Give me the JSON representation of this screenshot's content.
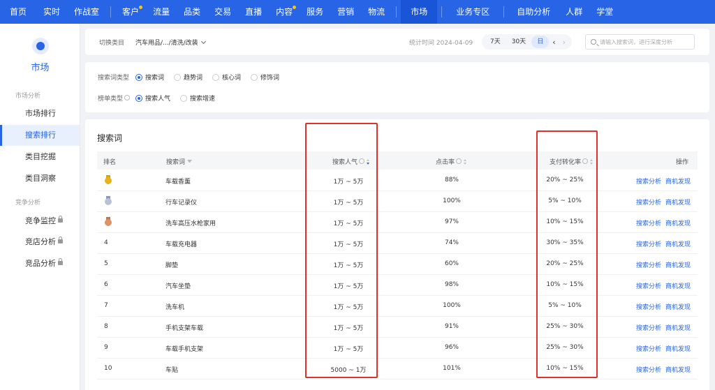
{
  "nav": {
    "items": [
      {
        "label": "首页",
        "dot": false
      },
      {
        "label": "实时",
        "dot": false
      },
      {
        "label": "作战室",
        "dot": false
      },
      {
        "label": "客户",
        "dot": true
      },
      {
        "label": "流量",
        "dot": false
      },
      {
        "label": "品类",
        "dot": false
      },
      {
        "label": "交易",
        "dot": false
      },
      {
        "label": "直播",
        "dot": false
      },
      {
        "label": "内容",
        "dot": true
      },
      {
        "label": "服务",
        "dot": false
      },
      {
        "label": "营销",
        "dot": false
      },
      {
        "label": "物流",
        "dot": false
      },
      {
        "label": "市场",
        "dot": false
      },
      {
        "label": "业务专区",
        "dot": false
      },
      {
        "label": "自助分析",
        "dot": false
      },
      {
        "label": "人群",
        "dot": false
      },
      {
        "label": "学堂",
        "dot": false
      }
    ],
    "active": "市场"
  },
  "sidebar": {
    "title": "市场",
    "groups": [
      {
        "label": "市场分析",
        "items": [
          {
            "label": "市场排行",
            "locked": false
          },
          {
            "label": "搜索排行",
            "locked": false,
            "active": true
          },
          {
            "label": "类目挖掘",
            "locked": false
          },
          {
            "label": "类目洞察",
            "locked": false
          }
        ]
      },
      {
        "label": "竞争分析",
        "items": [
          {
            "label": "竞争监控",
            "locked": true
          },
          {
            "label": "竞店分析",
            "locked": true
          },
          {
            "label": "竞品分析",
            "locked": true
          }
        ]
      }
    ]
  },
  "topbar": {
    "category_label": "切换类目",
    "category_value": "汽车用品/.../清洗/改装",
    "time_text": "统计时间 2024-04-09",
    "ranges": [
      "7天",
      "30天",
      "日"
    ],
    "selected_range": "日",
    "search_placeholder": "请输入搜索词，进行深度分析"
  },
  "filters": {
    "row1_label": "搜索词类型",
    "row1_options": [
      "搜索词",
      "趋势词",
      "核心词",
      "修饰词"
    ],
    "row1_selected": "搜索词",
    "row2_label": "榜单类型",
    "row2_options": [
      "搜索人气",
      "搜索增速"
    ],
    "row2_selected": "搜索人气"
  },
  "table": {
    "title": "搜索词",
    "columns": {
      "rank": "排名",
      "keyword": "搜索词",
      "popularity": "搜索人气",
      "ctr": "点击率",
      "conversion": "支付转化率",
      "action": "操作"
    },
    "action_labels": [
      "搜索分析",
      "商机发现"
    ],
    "rows": [
      {
        "rank": "1",
        "medal": "gold",
        "keyword": "车载香薰",
        "popularity": "1万 ~ 5万",
        "ctr": "88%",
        "conversion": "20% ~ 25%"
      },
      {
        "rank": "2",
        "medal": "silver",
        "keyword": "行车记录仪",
        "popularity": "1万 ~ 5万",
        "ctr": "100%",
        "conversion": "5% ~ 10%"
      },
      {
        "rank": "3",
        "medal": "bronze",
        "keyword": "洗车高压水枪家用",
        "popularity": "1万 ~ 5万",
        "ctr": "97%",
        "conversion": "10% ~ 15%"
      },
      {
        "rank": "4",
        "medal": "",
        "keyword": "车载充电器",
        "popularity": "1万 ~ 5万",
        "ctr": "74%",
        "conversion": "30% ~ 35%"
      },
      {
        "rank": "5",
        "medal": "",
        "keyword": "脚垫",
        "popularity": "1万 ~ 5万",
        "ctr": "60%",
        "conversion": "20% ~ 25%"
      },
      {
        "rank": "6",
        "medal": "",
        "keyword": "汽车坐垫",
        "popularity": "1万 ~ 5万",
        "ctr": "98%",
        "conversion": "10% ~ 15%"
      },
      {
        "rank": "7",
        "medal": "",
        "keyword": "洗车机",
        "popularity": "1万 ~ 5万",
        "ctr": "100%",
        "conversion": "5% ~ 10%"
      },
      {
        "rank": "8",
        "medal": "",
        "keyword": "手机支架车载",
        "popularity": "1万 ~ 5万",
        "ctr": "91%",
        "conversion": "25% ~ 30%"
      },
      {
        "rank": "9",
        "medal": "",
        "keyword": "车载手机支架",
        "popularity": "1万 ~ 5万",
        "ctr": "96%",
        "conversion": "25% ~ 30%"
      },
      {
        "rank": "10",
        "medal": "",
        "keyword": "车贴",
        "popularity": "5000 ~ 1万",
        "ctr": "101%",
        "conversion": "10% ~ 15%"
      }
    ]
  },
  "colors": {
    "brand": "#2864e6",
    "highlight_box": "#e0302a",
    "gold": "#e8b21e",
    "silver": "#b8c2d0",
    "bronze": "#d9926a"
  }
}
